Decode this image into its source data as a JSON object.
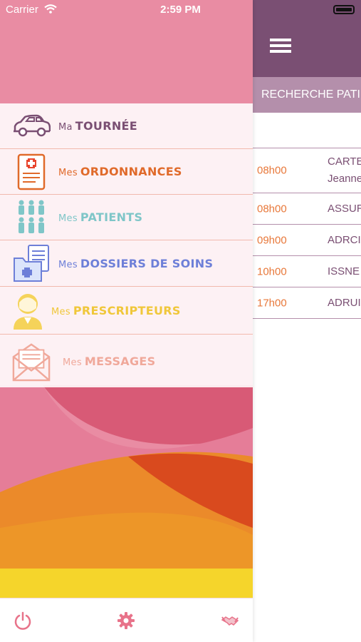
{
  "status_bar": {
    "carrier": "Carrier",
    "time": "2:59 PM"
  },
  "right_panel": {
    "search_label": "RECHERCHE PATIENT",
    "appointments": [
      {
        "time": "08h00",
        "name": "CARTE\nJeanne"
      },
      {
        "time": "08h00",
        "name": "ASSUR"
      },
      {
        "time": "09h00",
        "name": "ADRCI"
      },
      {
        "time": "10h00",
        "name": "ISSNE"
      },
      {
        "time": "17h00",
        "name": "ADRUI"
      }
    ]
  },
  "menu": {
    "items": [
      {
        "prefix": "Ma",
        "label": "TOURNÉE",
        "color": "#7a4f73",
        "icon": "car-icon"
      },
      {
        "prefix": "Mes",
        "label": "ORDONNANCES",
        "color": "#e06a2a",
        "icon": "prescription-icon"
      },
      {
        "prefix": "Mes",
        "label": "PATIENTS",
        "color": "#7fc6c8",
        "icon": "patients-group-icon"
      },
      {
        "prefix": "Mes",
        "label": "DOSSIERS DE SOINS",
        "color": "#6d7fd8",
        "icon": "medical-folder-icon"
      },
      {
        "prefix": "Mes",
        "label": "PRESCRIPTEURS",
        "color": "#f0c73a",
        "icon": "doctor-icon"
      },
      {
        "prefix": "Mes",
        "label": "MESSAGES",
        "color": "#f0a89a",
        "icon": "envelope-icon"
      }
    ]
  },
  "bottom_bar": {
    "icons": [
      "power-icon",
      "gear-icon",
      "handshake-icon"
    ],
    "color": "#e8738a"
  },
  "colors": {
    "drawer_pink": "#e98ca3",
    "header_purple": "#7a4f73",
    "search_bar": "#b48fab",
    "time_orange": "#e8783a"
  }
}
